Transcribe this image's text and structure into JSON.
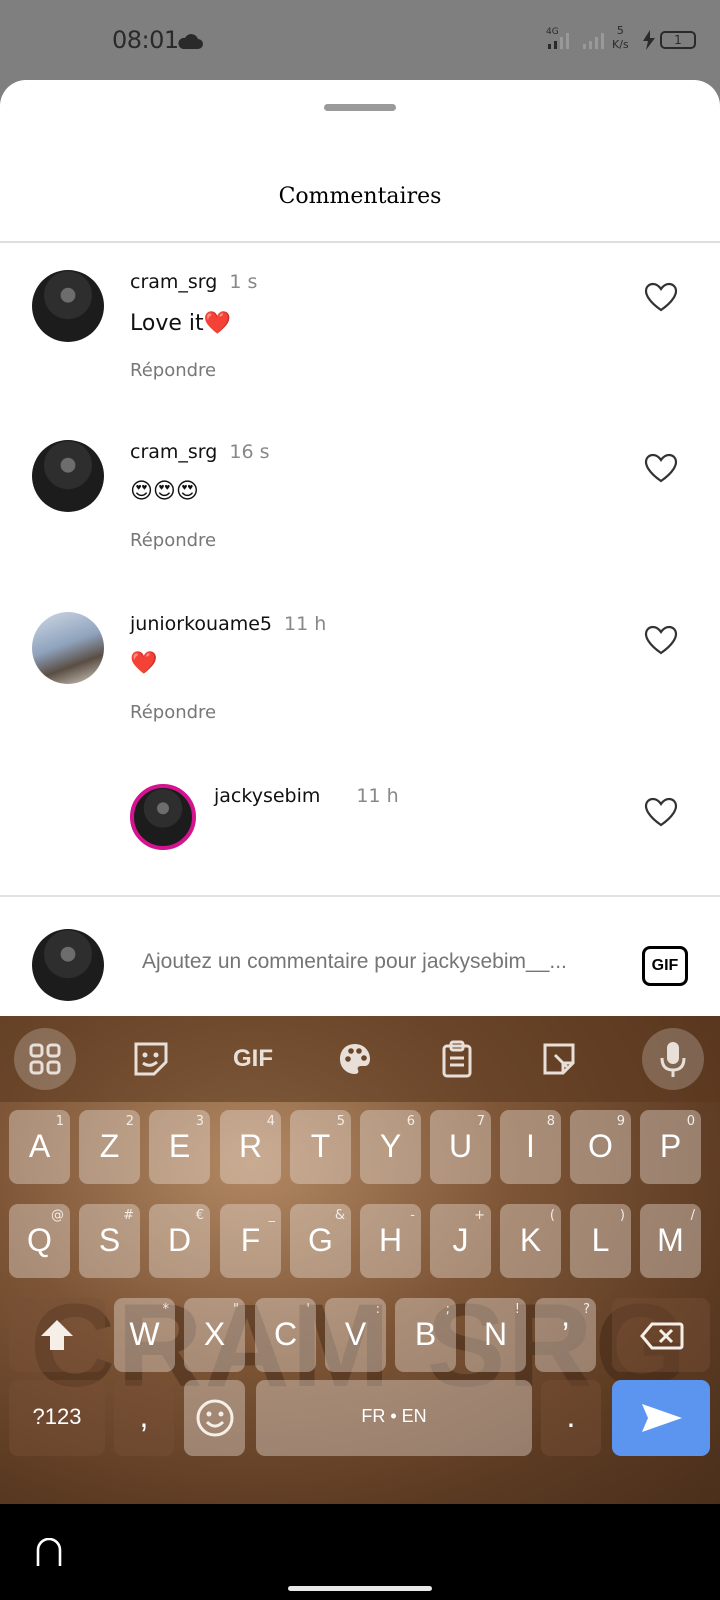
{
  "status_bar": {
    "time": "08:01",
    "network": "4G",
    "speed_value": "5",
    "speed_unit": "K/s",
    "battery": "1"
  },
  "sheet": {
    "title": "Commentaires"
  },
  "comments": [
    {
      "username": "cram_srg",
      "time": "1 s",
      "text": "Love it❤️",
      "reply_label": "Répondre"
    },
    {
      "username": "cram_srg",
      "time": "16 s",
      "text": "😍😍😍",
      "reply_label": "Répondre"
    },
    {
      "username": "juniorkouame5",
      "time": "11 h",
      "text": "❤️",
      "reply_label": "Répondre"
    },
    {
      "username": "jackysebim",
      "time": "11 h",
      "text": "",
      "reply_label": ""
    }
  ],
  "emoji_bar": [
    "❤️",
    "🙌",
    "🔥",
    "👏",
    "😢",
    "😍",
    "😮",
    "😂"
  ],
  "composer": {
    "placeholder": "Ajoutez un commentaire pour jackysebim__...",
    "gif_label": "GIF"
  },
  "keyboard": {
    "toolbar": {
      "gif_label": "GIF"
    },
    "watermark": "CRAM SRG",
    "rows": [
      [
        {
          "k": "A",
          "h": "1"
        },
        {
          "k": "Z",
          "h": "2"
        },
        {
          "k": "E",
          "h": "3"
        },
        {
          "k": "R",
          "h": "4"
        },
        {
          "k": "T",
          "h": "5"
        },
        {
          "k": "Y",
          "h": "6"
        },
        {
          "k": "U",
          "h": "7"
        },
        {
          "k": "I",
          "h": "8"
        },
        {
          "k": "O",
          "h": "9"
        },
        {
          "k": "P",
          "h": "0"
        }
      ],
      [
        {
          "k": "Q",
          "h": "@"
        },
        {
          "k": "S",
          "h": "#"
        },
        {
          "k": "D",
          "h": "€"
        },
        {
          "k": "F",
          "h": "_"
        },
        {
          "k": "G",
          "h": "&"
        },
        {
          "k": "H",
          "h": "-"
        },
        {
          "k": "J",
          "h": "+"
        },
        {
          "k": "K",
          "h": "("
        },
        {
          "k": "L",
          "h": ")"
        },
        {
          "k": "M",
          "h": "/"
        }
      ],
      [
        {
          "k": "W",
          "h": "*"
        },
        {
          "k": "X",
          "h": "\""
        },
        {
          "k": "C",
          "h": "'"
        },
        {
          "k": "V",
          "h": ":"
        },
        {
          "k": "B",
          "h": ";"
        },
        {
          "k": "N",
          "h": "!"
        },
        {
          "k": "’",
          "h": "?"
        }
      ]
    ],
    "symbols_label": "?123",
    "comma_label": ",",
    "space_label": "FR • EN",
    "period_label": "."
  }
}
